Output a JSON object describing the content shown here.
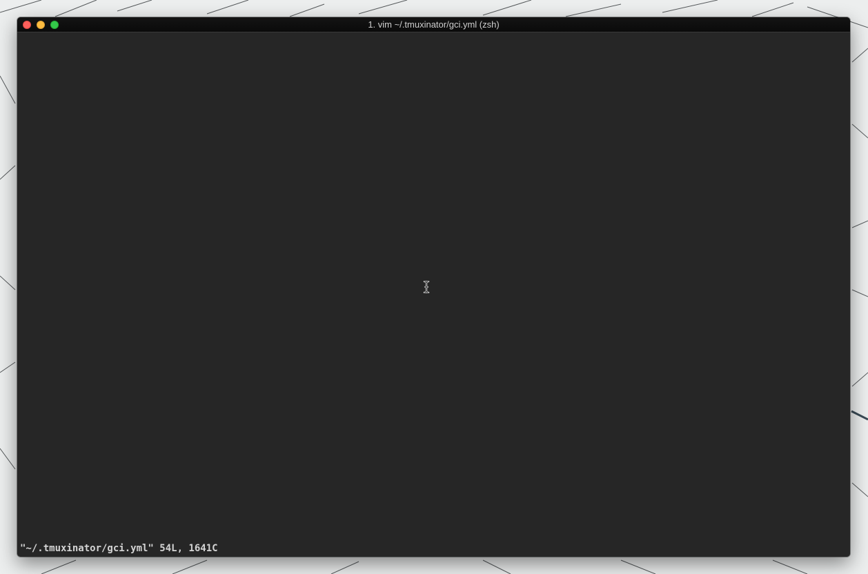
{
  "window": {
    "title": "1. vim ~/.tmuxinator/gci.yml (zsh)",
    "controls": {
      "close_color": "#fc605c",
      "minimize_color": "#fdbc40",
      "zoom_color": "#34c84a"
    }
  },
  "terminal": {
    "background": "#262626",
    "status_message": "\"~/.tmuxinator/gci.yml\" 54L, 1641C",
    "pointer_icon": "i-beam-cursor-icon"
  }
}
